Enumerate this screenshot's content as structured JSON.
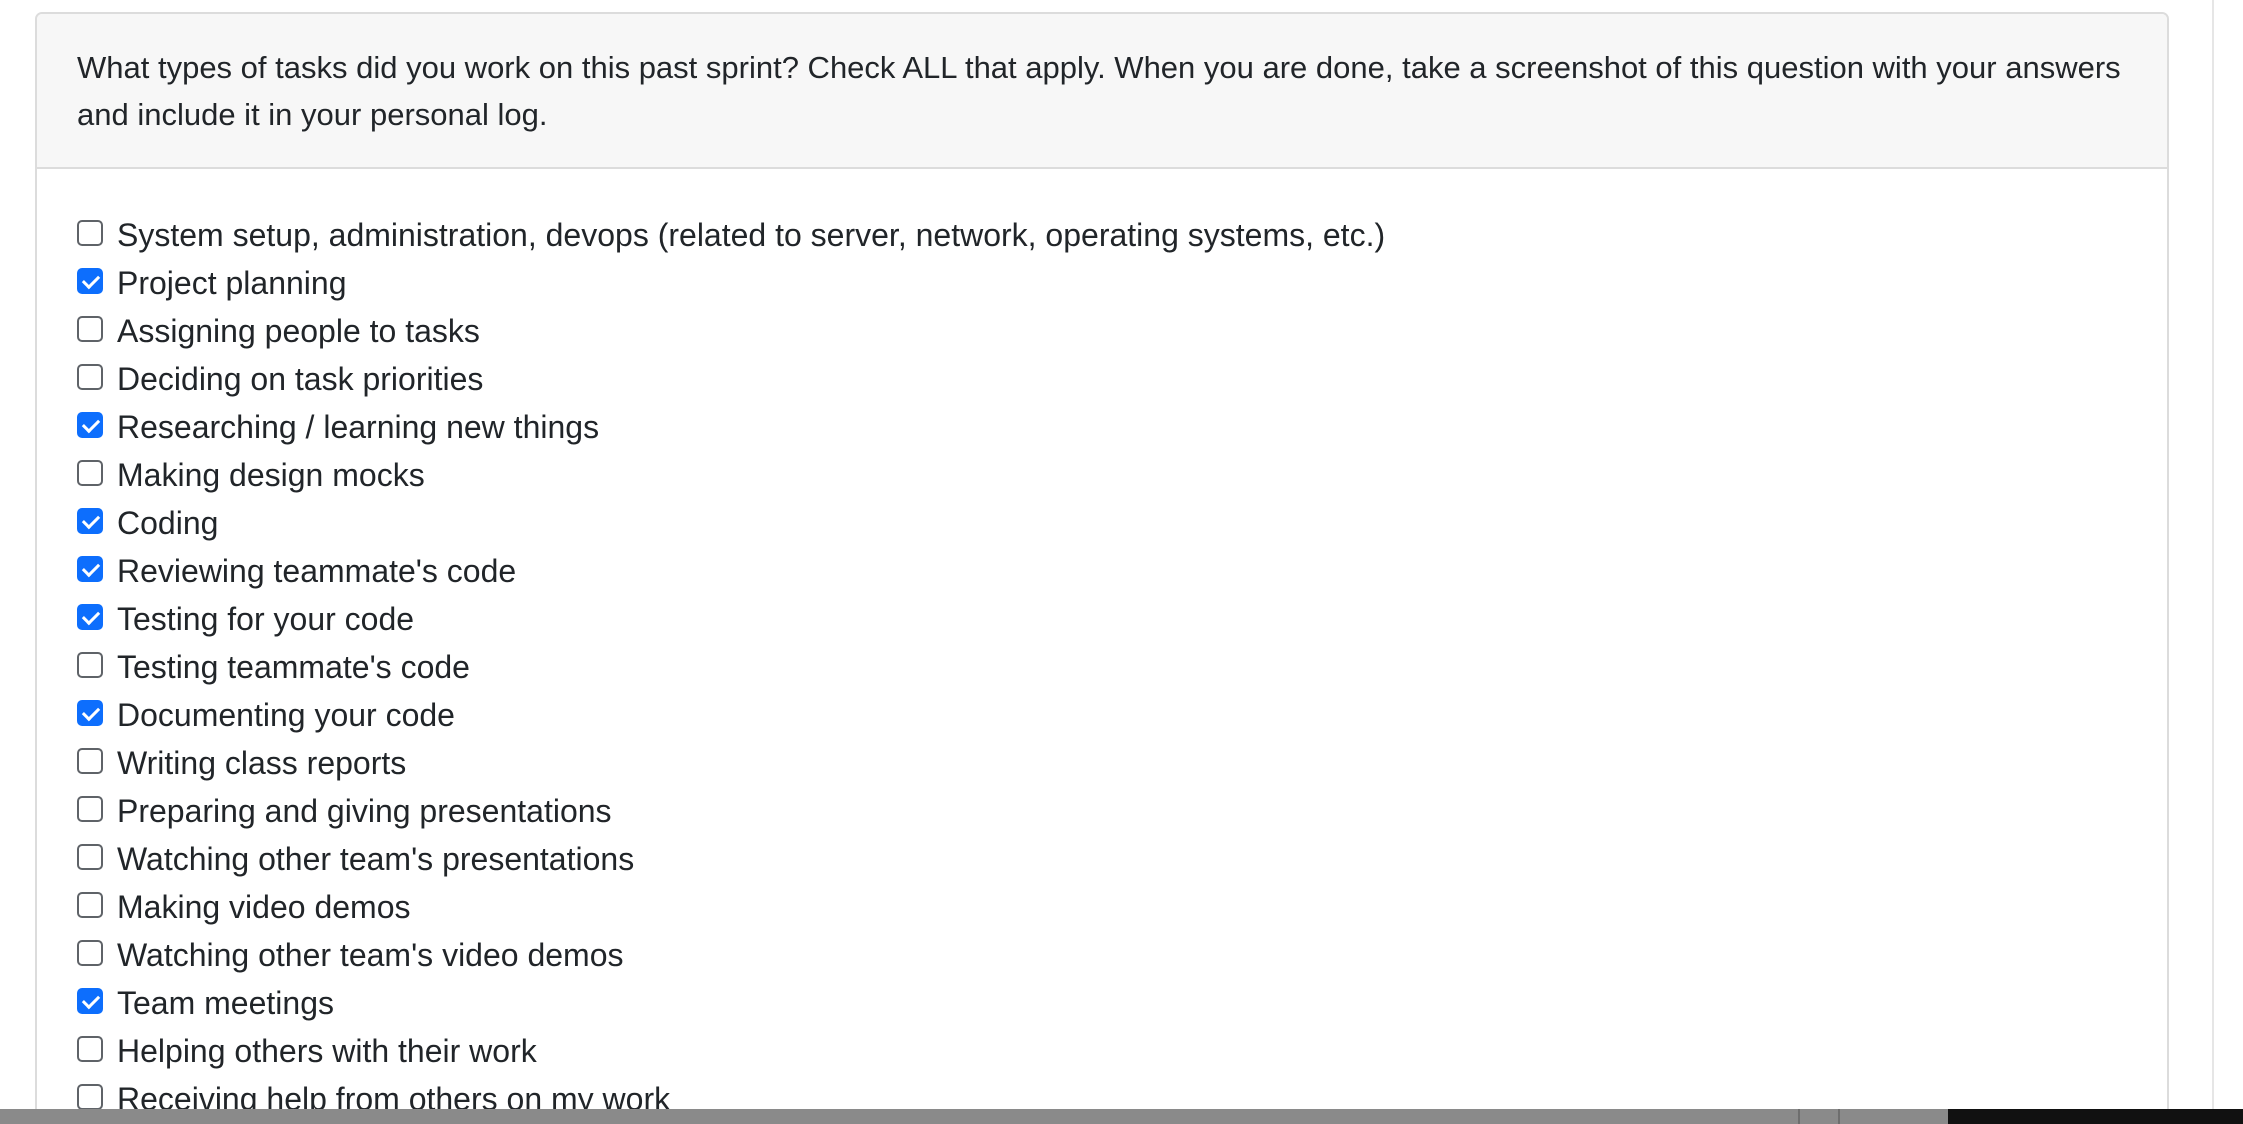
{
  "question": {
    "prompt": "What types of tasks did you work on this past sprint? Check ALL that apply. When you are done, take a screenshot of this question with your answers and include it in your personal log."
  },
  "options": [
    {
      "label": "System setup, administration, devops (related to server, network, operating systems, etc.)",
      "checked": false
    },
    {
      "label": "Project planning",
      "checked": true
    },
    {
      "label": "Assigning people to tasks",
      "checked": false
    },
    {
      "label": "Deciding on task priorities",
      "checked": false
    },
    {
      "label": "Researching / learning new things",
      "checked": true
    },
    {
      "label": "Making design mocks",
      "checked": false
    },
    {
      "label": "Coding",
      "checked": true
    },
    {
      "label": "Reviewing teammate's code",
      "checked": true
    },
    {
      "label": "Testing for your code",
      "checked": true
    },
    {
      "label": "Testing teammate's code",
      "checked": false
    },
    {
      "label": "Documenting your code",
      "checked": true
    },
    {
      "label": "Writing class reports",
      "checked": false
    },
    {
      "label": "Preparing and giving presentations",
      "checked": false
    },
    {
      "label": "Watching other team's presentations",
      "checked": false
    },
    {
      "label": "Making video demos",
      "checked": false
    },
    {
      "label": "Watching other team's video demos",
      "checked": false
    },
    {
      "label": "Team meetings",
      "checked": true
    },
    {
      "label": "Helping others with their work",
      "checked": false
    },
    {
      "label": "Receiving help from others on my work",
      "checked": false
    }
  ],
  "colors": {
    "checked_accent": "#0d6efd",
    "header_background": "#f7f7f7",
    "border": "#dcdcdc"
  }
}
